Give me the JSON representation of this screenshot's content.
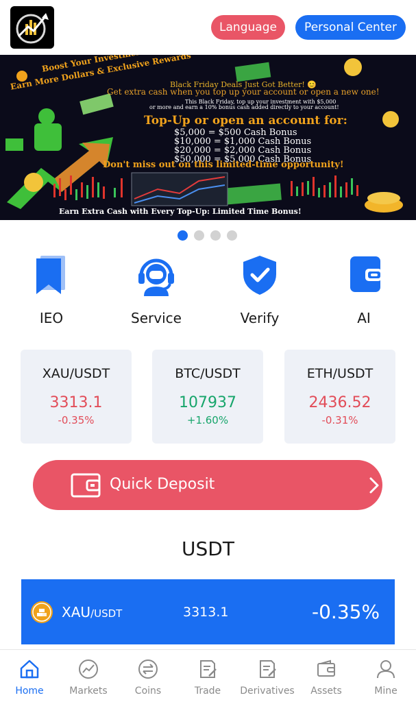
{
  "header": {
    "language_label": "Language",
    "personal_center_label": "Personal Center"
  },
  "banner": {
    "headline_line1": "Boost Your Investment:",
    "headline_line2": "Earn More Dollars & Exclusive Rewards",
    "bf_line": "Black Friday Deals Just Got Better! 😊",
    "extra_line": "Get extra cash when you top up your account or open a new one!",
    "small_line1": "This Black Friday, top up your investment with $5,000",
    "small_line2": "or more and earn a 10% bonus cash added directly to your account!",
    "topup_title": "Top-Up or open an account for:",
    "rewards": [
      "$5,000 = $500 Cash Bonus",
      "$10,000 = $1,000 Cash Bonus",
      "$20,000 = $2,000 Cash Bonus",
      "$50,000 = $5,000 Cash Bonus"
    ],
    "miss_line": "Don't miss out on this limited-time opportunity!",
    "footer_line": "Earn Extra Cash with Every Top-Up: Limited Time Bonus!"
  },
  "carousel": {
    "total": 4,
    "active_index": 0
  },
  "quick_nav": [
    {
      "label": "IEO",
      "icon": "bookmark-icon"
    },
    {
      "label": "Service",
      "icon": "headset-icon"
    },
    {
      "label": "Verify",
      "icon": "shield-check-icon"
    },
    {
      "label": "AI",
      "icon": "wallet-icon"
    }
  ],
  "tickers": [
    {
      "pair": "XAU/USDT",
      "price": "3313.1",
      "change": "-0.35%",
      "direction": "down"
    },
    {
      "pair": "BTC/USDT",
      "price": "107937",
      "change": "+1.60%",
      "direction": "up"
    },
    {
      "pair": "ETH/USDT",
      "price": "2436.52",
      "change": "-0.31%",
      "direction": "down"
    }
  ],
  "deposit": {
    "label": "Quick Deposit"
  },
  "section": {
    "title": "USDT"
  },
  "market_row": {
    "base": "XAU",
    "quote": "/USDT",
    "price": "3313.1",
    "change": "-0.35%"
  },
  "tabbar": {
    "active": "Home",
    "items": [
      {
        "label": "Home",
        "icon": "home-icon"
      },
      {
        "label": "Markets",
        "icon": "markets-icon"
      },
      {
        "label": "Coins",
        "icon": "coins-icon"
      },
      {
        "label": "Trade",
        "icon": "trade-icon"
      },
      {
        "label": "Derivatives",
        "icon": "derivatives-icon"
      },
      {
        "label": "Assets",
        "icon": "assets-icon"
      },
      {
        "label": "Mine",
        "icon": "user-icon"
      }
    ]
  },
  "colors": {
    "primary": "#1a6ef2",
    "accent_red": "#e95566",
    "down": "#e24c58",
    "up": "#17a56b",
    "card_bg": "#eef1f7"
  }
}
